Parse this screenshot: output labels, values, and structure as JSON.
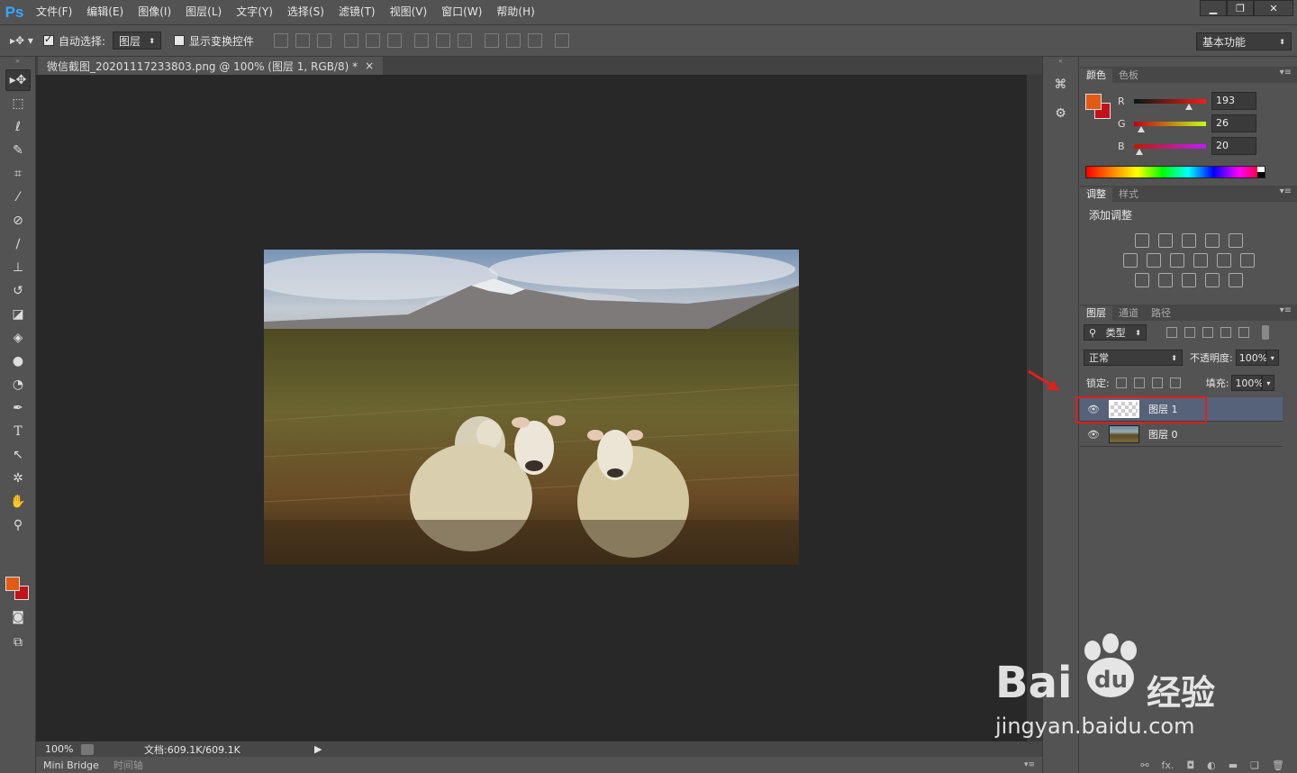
{
  "app": {
    "logo": "Ps",
    "menu": [
      "文件(F)",
      "编辑(E)",
      "图像(I)",
      "图层(L)",
      "文字(Y)",
      "选择(S)",
      "滤镜(T)",
      "视图(V)",
      "窗口(W)",
      "帮助(H)"
    ],
    "window_controls": [
      "minimize",
      "restore",
      "close"
    ]
  },
  "options": {
    "auto_select_label": "自动选择:",
    "auto_select_checked": true,
    "auto_select_target": "图层",
    "show_transform_label": "显示变换控件",
    "show_transform_checked": false,
    "workspace": "基本功能"
  },
  "document": {
    "tab_title": "微信截图_20201117233803.png @ 100% (图层 1, RGB/8) *",
    "zoom": "100%",
    "doc_info": "文档:609.1K/609.1K"
  },
  "bottom_tabs": [
    "Mini Bridge",
    "时间轴"
  ],
  "tools": [
    "move-icon",
    "marquee-icon",
    "lasso-icon",
    "quick-select-icon",
    "crop-icon",
    "eyedropper-icon",
    "healing-icon",
    "brush-icon",
    "stamp-icon",
    "history-brush-icon",
    "eraser-icon",
    "bucket-icon",
    "blur-icon",
    "dodge-icon",
    "pen-icon",
    "type-icon",
    "path-select-icon",
    "shape-icon",
    "hand-icon",
    "zoom-icon"
  ],
  "colors": {
    "foreground": "#e35a14",
    "background": "#c1111a",
    "selection": "#56627a",
    "highlight": "#e0201b"
  },
  "color_panel": {
    "tabs": [
      "颜色",
      "色板"
    ],
    "channels": [
      {
        "label": "R",
        "value": "193",
        "fraction": 0.76
      },
      {
        "label": "G",
        "value": "26",
        "fraction": 0.1
      },
      {
        "label": "B",
        "value": "20",
        "fraction": 0.08
      }
    ]
  },
  "adjustments_panel": {
    "tabs": [
      "调整",
      "样式"
    ],
    "title": "添加调整"
  },
  "layers_panel": {
    "tabs": [
      "图层",
      "通道",
      "路径"
    ],
    "filter_kind": "类型",
    "blend_mode": "正常",
    "opacity_label": "不透明度:",
    "opacity": "100%",
    "lock_label": "锁定:",
    "fill_label": "填充:",
    "fill": "100%",
    "layers": [
      {
        "name": "图层 1",
        "selected": true,
        "thumb": "transparent"
      },
      {
        "name": "图层 0",
        "selected": false,
        "thumb": "image"
      }
    ],
    "footer_icons": [
      "link-icon",
      "fx-icon",
      "mask-icon",
      "adjustment-icon",
      "folder-icon",
      "new-layer-icon",
      "trash-icon"
    ],
    "footer_fx": "fx."
  },
  "watermark": {
    "brand": "Bai",
    "brand2": "du",
    "cn": "经验",
    "url": "jingyan.baidu.com"
  }
}
